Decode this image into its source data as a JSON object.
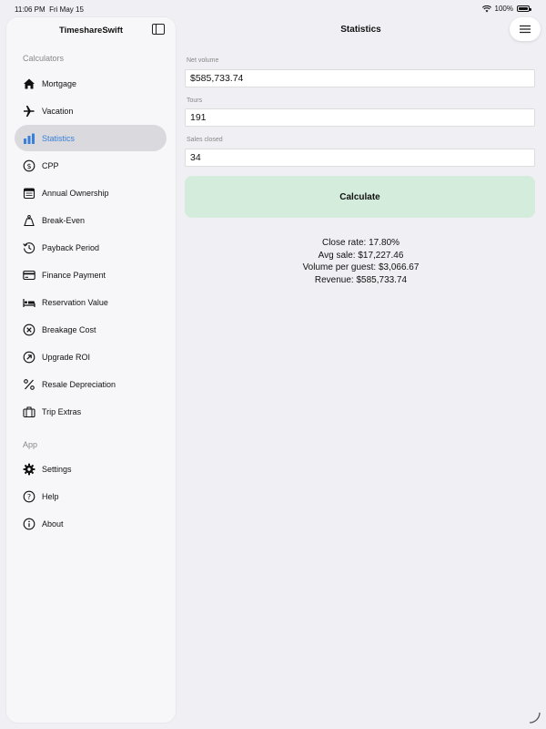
{
  "status": {
    "time": "11:06 PM",
    "date": "Fri May 15",
    "battery": "100%"
  },
  "sidebar": {
    "title": "TimeshareSwift",
    "section_calculators": "Calculators",
    "section_app": "App",
    "items": [
      {
        "label": "Mortgage",
        "icon": "house-icon"
      },
      {
        "label": "Vacation",
        "icon": "airplane-icon"
      },
      {
        "label": "Statistics",
        "icon": "chart-bar-icon",
        "selected": true
      },
      {
        "label": "CPP",
        "icon": "dollar-circle-icon"
      },
      {
        "label": "Annual Ownership",
        "icon": "calendar-icon"
      },
      {
        "label": "Break-Even",
        "icon": "scale-icon"
      },
      {
        "label": "Payback Period",
        "icon": "clock-arrow-icon"
      },
      {
        "label": "Finance Payment",
        "icon": "credit-card-icon"
      },
      {
        "label": "Reservation Value",
        "icon": "bed-icon"
      },
      {
        "label": "Breakage Cost",
        "icon": "x-circle-icon"
      },
      {
        "label": "Upgrade ROI",
        "icon": "arrow-up-right-circle-icon"
      },
      {
        "label": "Resale Depreciation",
        "icon": "percent-icon"
      },
      {
        "label": "Trip Extras",
        "icon": "suitcase-icon"
      }
    ],
    "app_items": [
      {
        "label": "Settings",
        "icon": "gear-icon"
      },
      {
        "label": "Help",
        "icon": "question-circle-icon"
      },
      {
        "label": "About",
        "icon": "info-circle-icon"
      }
    ]
  },
  "main": {
    "title": "Statistics",
    "fields": [
      {
        "label": "Net volume",
        "value": "$585,733.74"
      },
      {
        "label": "Tours",
        "value": "191"
      },
      {
        "label": "Sales closed",
        "value": "34"
      }
    ],
    "calculate_label": "Calculate",
    "results": {
      "close_rate": "Close rate: 17.80%",
      "avg_sale": "Avg sale: $17,227.46",
      "volume_per_guest": "Volume per guest: $3,066.67",
      "revenue": "Revenue: $585,733.74"
    }
  },
  "colors": {
    "accent": "#3a7fd9",
    "calculate_bg": "#d4ecdc",
    "selected_bg": "#d9d9de"
  }
}
